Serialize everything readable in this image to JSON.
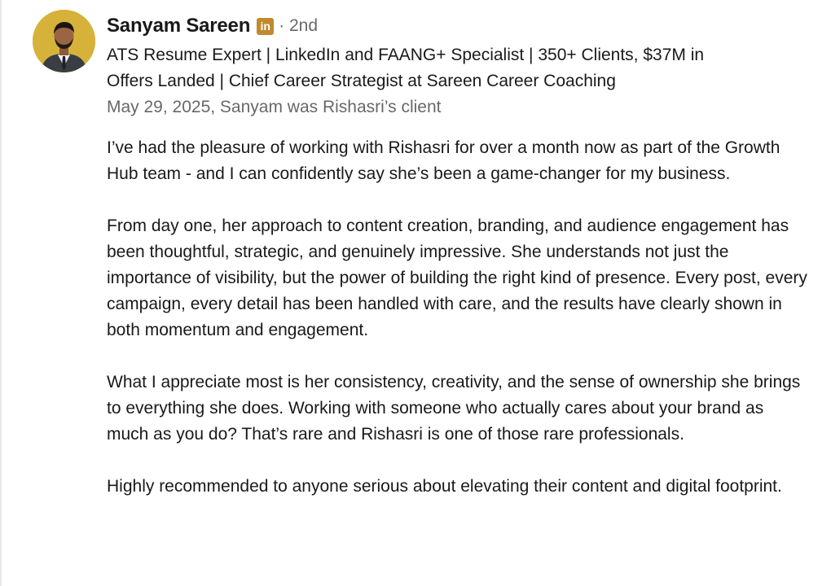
{
  "recommendation": {
    "author": {
      "name": "Sanyam Sareen",
      "badge_icon": "linkedin-premium-icon",
      "badge_text": "in",
      "connection_degree": "· 2nd",
      "headline_line1": "ATS Resume Expert | LinkedIn and FAANG+ Specialist | 350+ Clients, $37M in",
      "headline_line2": "Offers Landed | Chief Career Strategist at Sareen Career Coaching",
      "meta": "May 29, 2025, Sanyam was Rishasri’s client"
    },
    "paragraphs": [
      "I’ve had the pleasure of working with Rishasri for over a month now as part of the Growth Hub team - and I can confidently say she’s been a game-changer for my business.",
      "From day one, her approach to content creation, branding, and audience engagement has been thoughtful, strategic, and genuinely impressive. She understands not just the importance of visibility, but the power of building the right kind of presence. Every post, every campaign, every detail has been handled with care, and the results have clearly shown in both momentum and engagement.",
      "What I appreciate most is her consistency, creativity, and the sense of ownership she brings to everything she does. Working with someone who actually cares about your brand as much as you do? That’s rare and Rishasri is one of those rare professionals.",
      "Highly recommended to anyone serious about elevating their content and digital footprint."
    ]
  },
  "colors": {
    "avatar_background": "#d7b23a",
    "premium_badge": "#c08a2e",
    "primary_text": "#1a1a1a",
    "secondary_text": "#666666"
  }
}
